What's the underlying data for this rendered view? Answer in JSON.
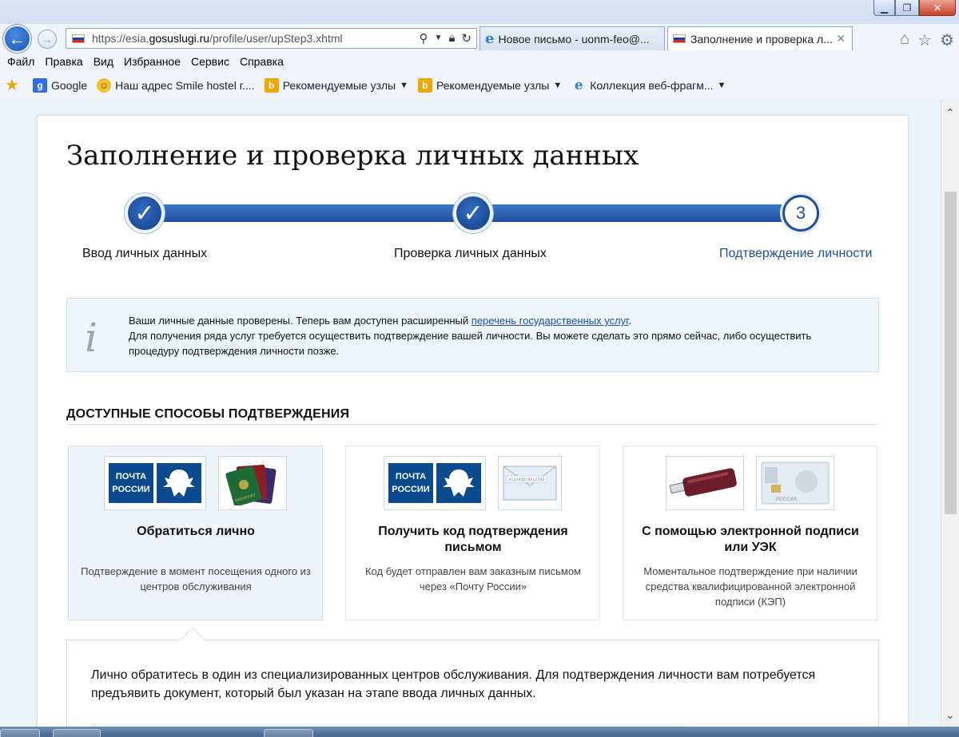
{
  "browser": {
    "url_prefix": "https://esia.",
    "url_domain": "gosuslugi.ru",
    "url_path": "/profile/user/upStep3.xhtml",
    "tabs": [
      {
        "label": "Новое письмо - uonm-feo@..."
      },
      {
        "label": "Заполнение и проверка л...",
        "close": "✕"
      }
    ],
    "menu": [
      "Файл",
      "Правка",
      "Вид",
      "Избранное",
      "Сервис",
      "Справка"
    ],
    "favorites": [
      {
        "label": "Google"
      },
      {
        "label": "Наш адрес Smile hostel г...."
      },
      {
        "label": "Рекомендуемые узлы"
      },
      {
        "label": "Рекомендуемые узлы"
      },
      {
        "label": "Коллекция веб-фрагм..."
      }
    ]
  },
  "page": {
    "title": "Заполнение и проверка личных данных",
    "steps": [
      {
        "label": "Ввод личных данных",
        "state": "done"
      },
      {
        "label": "Проверка личных данных",
        "state": "done"
      },
      {
        "label": "Подтверждение личности",
        "state": "current",
        "number": "3"
      }
    ],
    "info": {
      "line1_before": "Ваши личные данные проверены. Теперь вам доступен расширенный ",
      "line1_link": "перечень государственных услуг",
      "line1_after": ".",
      "line2": "Для получения ряда услуг требуется осуществить подтверждение вашей личности. Вы можете сделать это прямо сейчас, либо осуществить процедуру подтверждения личности позже."
    },
    "methods_title": "ДОСТУПНЫЕ СПОСОБЫ ПОДТВЕРЖДЕНИЯ",
    "methods": [
      {
        "title": "Обратиться лично",
        "desc": "Подтверждение в момент посещения одного из центров обслуживания"
      },
      {
        "title": "Получить код подтверждения письмом",
        "desc": "Код будет отправлен вам заказным письмом через «Почту России»"
      },
      {
        "title": "С помощью электронной подписи или УЭК",
        "desc": "Моментальное подтверждение при наличии средства квалифицированной электронной подписи (КЭП)"
      }
    ],
    "post_logo": {
      "line1": "ПОЧТА",
      "line2": "РОССИИ"
    },
    "passport_label": "PASSPORT",
    "envelope_code": "01234567891234S",
    "card_label": "РОССИЯ",
    "details_text": "Лично обратитесь в один из специализированных центров обслуживания. Для подтверждения личности вам потребуется предъявить документ, который был указан на этапе ввода личных данных."
  },
  "colors": {
    "brand_blue": "#1e4f9c",
    "link": "#1c4fb0",
    "post_blue": "#0b4a8c"
  }
}
